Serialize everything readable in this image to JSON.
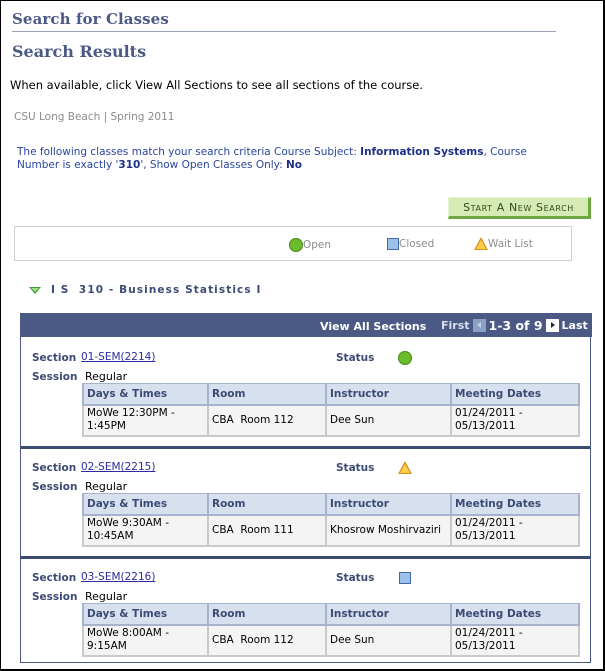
{
  "header": {
    "title": "Search for Classes",
    "subtitle": "Search Results",
    "instructions": "When available, click View All Sections to see all sections of the course.",
    "institution_term": "CSU Long Beach | Spring 2011"
  },
  "criteria": {
    "prefix": "The following classes match your search criteria Course Subject: ",
    "subject": "Information Systems",
    "mid1": ",  Course Number is exactly '",
    "number": "310",
    "mid2": "',  Show Open Classes Only: ",
    "open_only": "No"
  },
  "buttons": {
    "new_search": "Start A New Search"
  },
  "legend": {
    "open": "Open",
    "closed": "Closed",
    "wait_list": "Wait List"
  },
  "colors": {
    "header_blue": "#4a5a84",
    "open_green": "#6cbb2c",
    "closed_blue": "#9ec1ec",
    "wait_yellow": "#ffcf4c",
    "button_green": "#d6ebb4"
  },
  "course": {
    "title": "I S  310 - Business Statistics I",
    "toggle_icon": "collapse-triangle-icon"
  },
  "grid": {
    "view_all": "View All Sections",
    "first": "First",
    "range": "1-3 of 9",
    "last": "Last",
    "labels": {
      "section": "Section",
      "session": "Session",
      "status": "Status"
    },
    "columns": [
      "Days & Times",
      "Room",
      "Instructor",
      "Meeting Dates"
    ],
    "sections": [
      {
        "section": "01-SEM(2214)",
        "status": "Open",
        "session": "Regular",
        "days_times": "MoWe 12:30PM - 1:45PM",
        "room": "CBA  Room 112",
        "instructor": "Dee Sun",
        "meeting_dates": "01/24/2011 - 05/13/2011"
      },
      {
        "section": "02-SEM(2215)",
        "status": "Wait List",
        "session": "Regular",
        "days_times": "MoWe 9:30AM - 10:45AM",
        "room": "CBA  Room 111",
        "instructor": "Khosrow Moshirvaziri",
        "meeting_dates": "01/24/2011 - 05/13/2011"
      },
      {
        "section": "03-SEM(2216)",
        "status": "Closed",
        "session": "Regular",
        "days_times": "MoWe 8:00AM - 9:15AM",
        "room": "CBA  Room 112",
        "instructor": "Dee Sun",
        "meeting_dates": "01/24/2011 - 05/13/2011"
      }
    ]
  }
}
